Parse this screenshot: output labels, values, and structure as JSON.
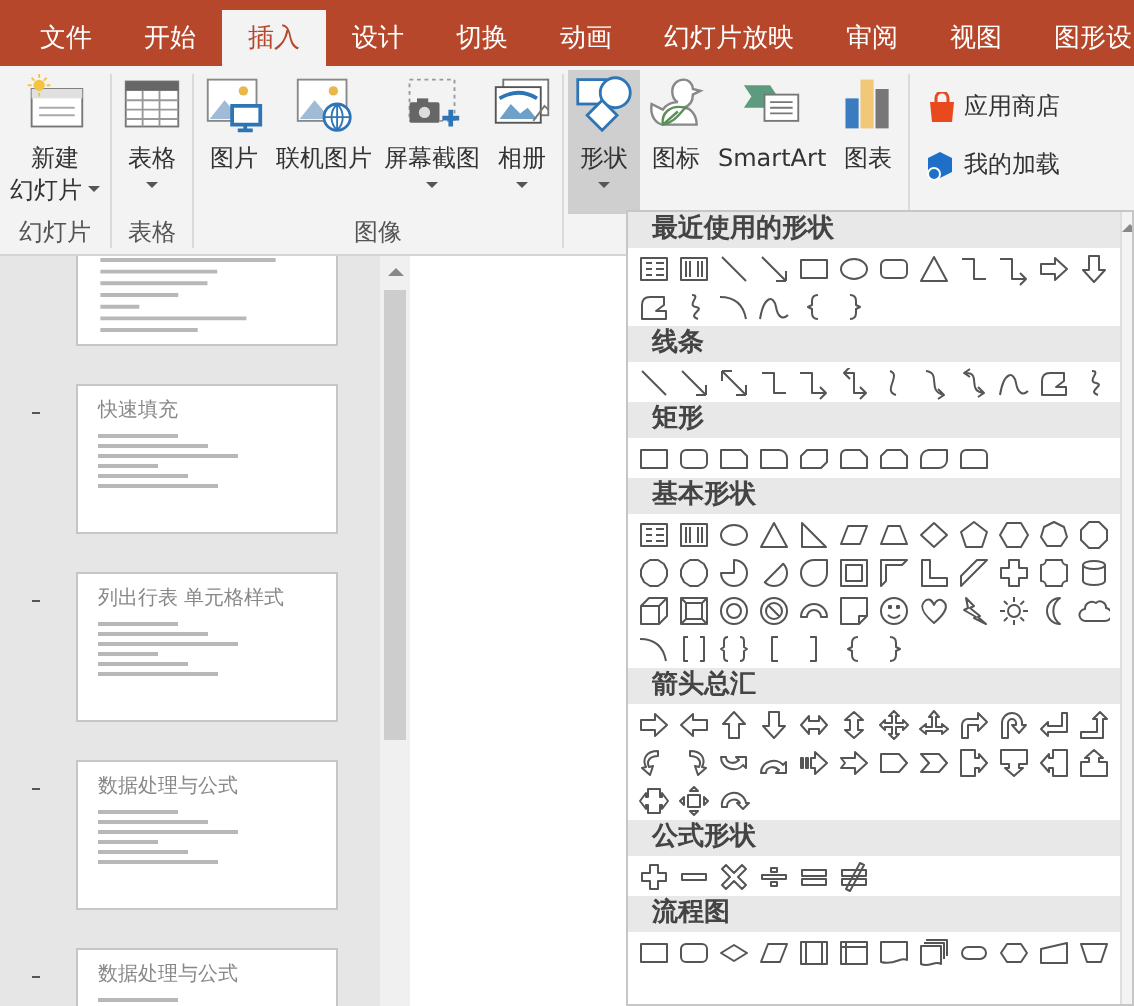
{
  "tabs": [
    {
      "label": "文件",
      "selected": false
    },
    {
      "label": "开始",
      "selected": false
    },
    {
      "label": "插入",
      "selected": true
    },
    {
      "label": "设计",
      "selected": false
    },
    {
      "label": "切换",
      "selected": false
    },
    {
      "label": "动画",
      "selected": false
    },
    {
      "label": "幻灯片放映",
      "selected": false
    },
    {
      "label": "审阅",
      "selected": false
    },
    {
      "label": "视图",
      "selected": false
    },
    {
      "label": "图形设",
      "selected": false
    }
  ],
  "ribbon": {
    "groups": [
      {
        "label": "幻灯片",
        "buttons": [
          {
            "kind": "new-slide",
            "lines": [
              "新建",
              "幻灯片"
            ],
            "dropdown": true,
            "pressed": false
          }
        ]
      },
      {
        "label": "表格",
        "buttons": [
          {
            "kind": "table",
            "lines": [
              "表格"
            ],
            "dropdown": true,
            "pressed": false
          }
        ]
      },
      {
        "label": "图像",
        "buttons": [
          {
            "kind": "picture",
            "lines": [
              "图片"
            ],
            "dropdown": false,
            "pressed": false
          },
          {
            "kind": "online-picture",
            "lines": [
              "联机图片"
            ],
            "dropdown": false,
            "pressed": false
          },
          {
            "kind": "screenshot",
            "lines": [
              "屏幕截图"
            ],
            "dropdown": true,
            "pressed": false
          },
          {
            "kind": "album",
            "lines": [
              "相册"
            ],
            "dropdown": true,
            "pressed": false
          }
        ]
      },
      {
        "buttons": [
          {
            "kind": "shapes",
            "lines": [
              "形状"
            ],
            "dropdown": true,
            "pressed": true
          },
          {
            "kind": "icons",
            "lines": [
              "图标"
            ],
            "dropdown": false,
            "pressed": false
          },
          {
            "kind": "smartart",
            "lines": [
              "SmartArt"
            ],
            "dropdown": false,
            "pressed": false
          },
          {
            "kind": "chart",
            "lines": [
              "图表"
            ],
            "dropdown": false,
            "pressed": false
          }
        ]
      },
      {
        "small_buttons": [
          {
            "kind": "store",
            "label": "应用商店"
          },
          {
            "kind": "addins",
            "label": "我的加载"
          }
        ]
      }
    ]
  },
  "slides": [
    {
      "kind": "body-only"
    },
    {
      "kind": "titled",
      "title": "快速填充"
    },
    {
      "kind": "titled",
      "title": "列出行表  单元格样式"
    },
    {
      "kind": "titled",
      "title": "数据处理与公式"
    },
    {
      "kind": "titled",
      "title": "数据处理与公式"
    }
  ],
  "shapes_gallery": {
    "sections": [
      {
        "title": "最近使用的形状",
        "kind": "recent"
      },
      {
        "title": "线条",
        "kind": "lines"
      },
      {
        "title": "矩形",
        "kind": "rectangles"
      },
      {
        "title": "基本形状",
        "kind": "basic"
      },
      {
        "title": "箭头总汇",
        "kind": "arrows"
      },
      {
        "title": "公式形状",
        "kind": "equation"
      },
      {
        "title": "流程图",
        "kind": "flowchart"
      }
    ]
  }
}
